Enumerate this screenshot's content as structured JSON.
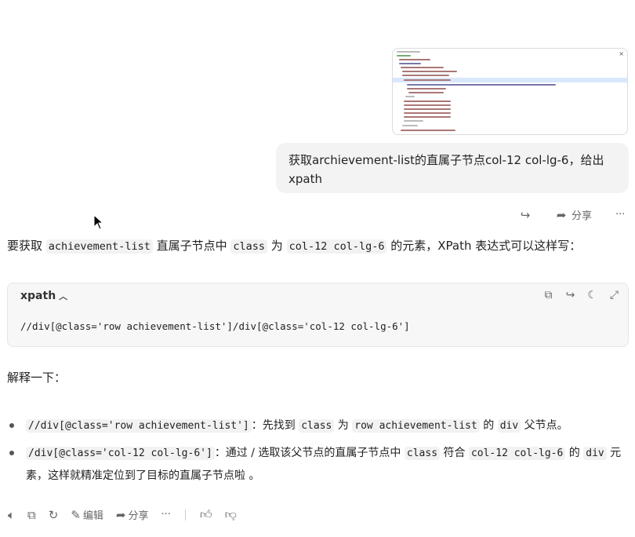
{
  "user_message": {
    "text": "获取archievement-list的直属子节点col-12 col-lg-6，给出xpath",
    "thumbnail_close": "×"
  },
  "message_actions": {
    "forward_icon": "forward-icon",
    "share_label": "分享",
    "more_label": "···"
  },
  "answer": {
    "intro_1": "要获取 ",
    "intro_code_1": "achievement-list",
    "intro_2": " 直属子节点中 ",
    "intro_code_2": "class",
    "intro_3": " 为 ",
    "intro_code_3": "col-12 col-lg-6",
    "intro_4": " 的元素，XPath 表达式可以这样写：",
    "code_lang": "xpath",
    "code_text": "//div[@class='row achievement-list']/div[@class='col-12 col-lg-6']",
    "explain_heading": "解释一下：",
    "bullet_1": {
      "code": "//div[@class='row achievement-list']",
      "t1": "：先找到 ",
      "c2": "class",
      "t2": " 为 ",
      "c3": "row achievement-list",
      "t3": " 的 ",
      "c4": "div",
      "t4": " 父节点。"
    },
    "bullet_2": {
      "code": "/div[@class='col-12 col-lg-6']",
      "t1": "：通过 / 选取该父节点的直属子节点中 ",
      "c2": "class",
      "t2": " 符合 ",
      "c3": "col-12 col-lg-6",
      "t3": " 的 ",
      "c4": "div",
      "t4": " 元素，这样就精准定位到了目标的直属子节点啦 。"
    }
  },
  "bottom_actions": {
    "edit_label": "编辑",
    "share_label": "分享",
    "more_label": "···"
  }
}
